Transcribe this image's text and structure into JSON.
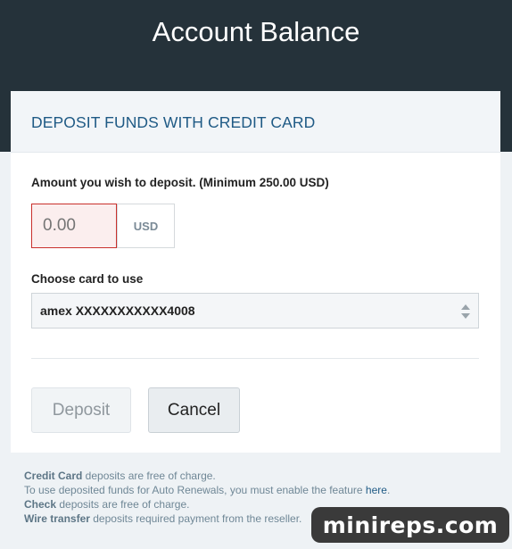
{
  "header": {
    "title": "Account Balance"
  },
  "card": {
    "title": "DEPOSIT FUNDS WITH CREDIT CARD",
    "amount_label": "Amount you wish to deposit. (Minimum 250.00 USD)",
    "amount_value": "",
    "amount_placeholder": "0.00",
    "currency": "USD",
    "card_label": "Choose card to use",
    "card_selected": "amex XXXXXXXXXXX4008",
    "deposit_button": "Deposit",
    "cancel_button": "Cancel"
  },
  "notes": {
    "line1_bold": "Credit Card",
    "line1_rest": " deposits are free of charge.",
    "line2_text": "To use deposited funds for Auto Renewals, you must enable the feature ",
    "line2_link": "here",
    "line2_end": ".",
    "line3_bold": "Check",
    "line3_rest": " deposits are free of charge.",
    "line4_bold": "Wire transfer",
    "line4_rest": " deposits required payment from the reseller."
  },
  "watermark": "minireps.com",
  "colors": {
    "header_bg": "#25323a",
    "accent": "#1f5a85",
    "error_border": "#c9302c"
  }
}
